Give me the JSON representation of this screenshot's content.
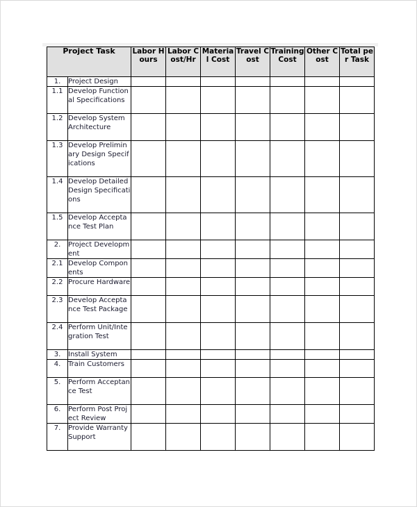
{
  "document": {
    "type": "project-cost-estimate-table",
    "table": {
      "headers": {
        "task_group_label": "Project Task",
        "columns": [
          "Labor Hours",
          "Labor Cost/Hr",
          "Material Cost",
          "Travel Cost",
          "Training Cost",
          "Other Cost",
          "Total per Task"
        ]
      },
      "rows": [
        {
          "number": "1.",
          "task": "Project Design",
          "lines": 1
        },
        {
          "number": "1.1",
          "task": "Develop Functional Specifications",
          "lines": 3
        },
        {
          "number": "1.2",
          "task": "Develop System Architecture",
          "lines": 3
        },
        {
          "number": "1.3",
          "task": "Develop Preliminary Design Specifications",
          "lines": 4
        },
        {
          "number": "1.4",
          "task": "Develop Detailed Design Specifications",
          "lines": 4
        },
        {
          "number": "1.5",
          "task": "Develop Acceptance Test Plan",
          "lines": 3
        },
        {
          "number": "2.",
          "task": "Project Development",
          "lines": 2
        },
        {
          "number": "2.1",
          "task": "Develop Components",
          "lines": 2
        },
        {
          "number": "2.2",
          "task": "Procure Hardware",
          "lines": 2
        },
        {
          "number": "2.3",
          "task": "Develop Acceptance Test Package",
          "lines": 3
        },
        {
          "number": "2.4",
          "task": "Perform Unit/Integration Test",
          "lines": 3
        },
        {
          "number": "3.",
          "task": "Install System",
          "lines": 1
        },
        {
          "number": "4.",
          "task": "Train Customers",
          "lines": 2
        },
        {
          "number": "5.",
          "task": "Perform Acceptance Test",
          "lines": 3
        },
        {
          "number": "6.",
          "task": "Perform Post Project Review",
          "lines": 2
        },
        {
          "number": "7.",
          "task": "Provide Warranty Support",
          "lines": 3
        }
      ],
      "data_column_count": 7,
      "cell_values": "",
      "colors": {
        "header_fill": "#e0e0e0",
        "border": "#000000",
        "text": "#1a1a2e",
        "page_background": "#ffffff",
        "top_strip": "#f1f1f1"
      }
    }
  }
}
